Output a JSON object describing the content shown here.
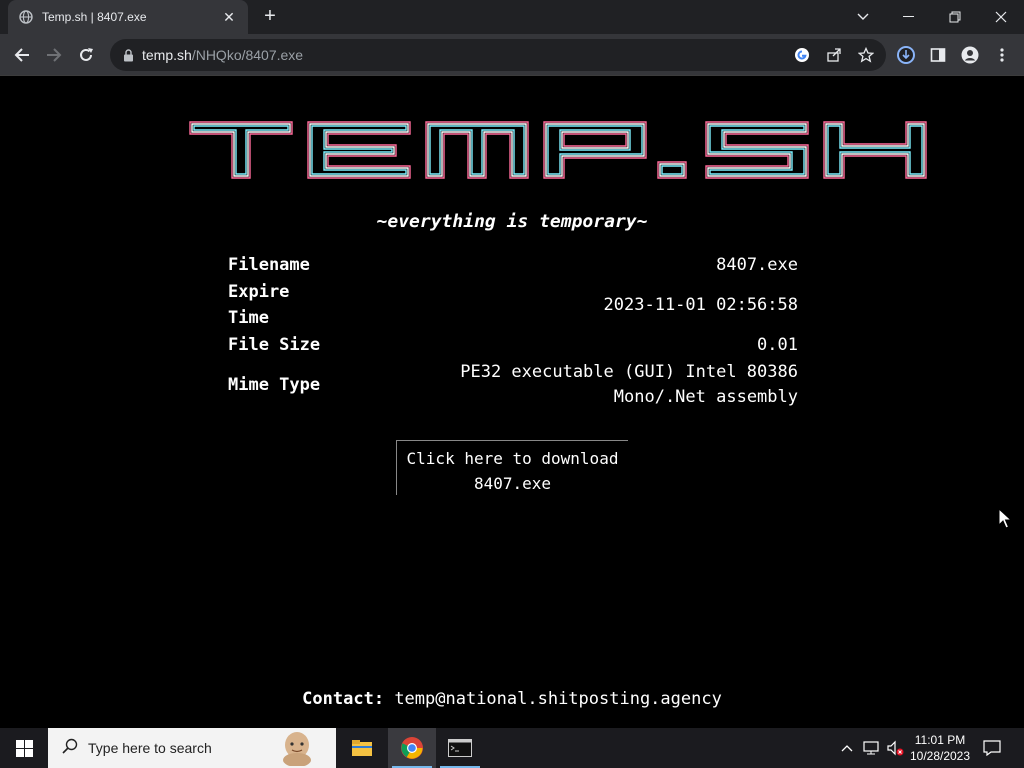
{
  "browser": {
    "tab_title": "Temp.sh | 8407.exe",
    "tab_close": "✕",
    "new_tab": "+",
    "url_host": "temp.sh",
    "url_path": "/NHQko/8407.exe"
  },
  "page": {
    "logo_text": "TEMP.SH",
    "tagline": "~everything is temporary~",
    "info": {
      "filename_label": "Filename",
      "filename_value": "8407.exe",
      "expire_label_1": "Expire",
      "expire_label_2": "Time",
      "expire_value": "2023-11-01 02:56:58",
      "size_label": "File Size",
      "size_value": "0.01",
      "mime_label": "Mime Type",
      "mime_value_1": "PE32 executable (GUI) Intel 80386",
      "mime_value_2": "Mono/.Net assembly"
    },
    "download": {
      "line_1": "Click here to download",
      "line_2": "8407.exe"
    },
    "contact": {
      "label": "Contact:",
      "email": "temp@national.shitposting.agency"
    }
  },
  "taskbar": {
    "search_placeholder": "Type here to search",
    "time": "11:01 PM",
    "date": "10/28/2023"
  },
  "colors": {
    "chrome_dark": "#202124",
    "chrome_tab": "#35363a",
    "page_bg": "#000000",
    "taskbar_bg": "#1b1b1f"
  }
}
